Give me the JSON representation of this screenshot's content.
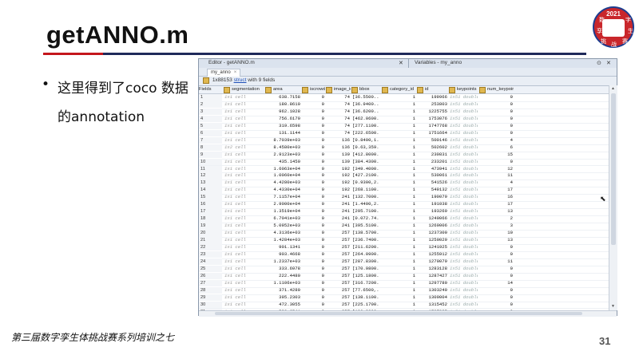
{
  "slide": {
    "title": "getANNO.m",
    "bullet": "•",
    "text": "这里得到了coco 数据的annotation",
    "footer": "第三届数字孪生体挑战赛系列培训之七",
    "page_number": "31"
  },
  "logo": {
    "year": "2021",
    "chars": [
      "数",
      "字",
      "孪",
      "生",
      "挑",
      "战",
      "赛"
    ]
  },
  "window": {
    "editor_title": "Editor - getANNO.m",
    "variables_title": "Variables - my_anno",
    "tab_label": "my_anno",
    "info_size": "1x88153",
    "info_type": "struct",
    "info_suffix": "with 9 fields",
    "colors": {
      "accent_red": "#c4161c",
      "accent_navy": "#1f2a5a",
      "struct_icon": "#e0b850"
    },
    "columns": [
      "Fields",
      "segmentation",
      "area",
      "iscrowd",
      "image_id",
      "bbox",
      "category_id",
      "id",
      "keypoints",
      "num_keypoints"
    ],
    "rows": [
      [
        "1",
        "1x1 cell",
        "638.7158",
        "0",
        "74",
        "[36.5500...",
        "1",
        "199966",
        "1x51 double",
        "0"
      ],
      [
        "2",
        "1x1 cell",
        "180.8610",
        "0",
        "74",
        "[36.9400...",
        "1",
        "253803",
        "1x51 double",
        "0"
      ],
      [
        "3",
        "1x1 cell",
        "962.1028",
        "0",
        "74",
        "[36.6200...",
        "1",
        "1225755",
        "1x51 double",
        "0"
      ],
      [
        "4",
        "1x1 cell",
        "756.6170",
        "0",
        "74",
        "[462.0600...",
        "1",
        "1753076",
        "1x51 double",
        "0"
      ],
      [
        "5",
        "1x1 cell",
        "319.6598",
        "0",
        "74",
        "[277.1100...",
        "1",
        "1747768",
        "1x51 double",
        "0"
      ],
      [
        "6",
        "1x1 cell",
        "131.1144",
        "0",
        "74",
        "[222.6500...",
        "1",
        "1751664",
        "1x51 double",
        "0"
      ],
      [
        "7",
        "1x1 cell",
        "8.7039e+03",
        "0",
        "136",
        "[0.8400,1...",
        "1",
        "500146",
        "1x51 double",
        "4"
      ],
      [
        "8",
        "1x2 cell",
        "8.4580e+03",
        "0",
        "136",
        "[0.63,359...",
        "1",
        "502602",
        "1x51 double",
        "6"
      ],
      [
        "9",
        "1x1 cell",
        "2.9123e+03",
        "0",
        "139",
        "[412.8000...",
        "1",
        "230831",
        "1x51 double",
        "15"
      ],
      [
        "10",
        "1x1 cell",
        "435.1450",
        "0",
        "139",
        "[384.4300...",
        "1",
        "233201",
        "1x51 double",
        "0"
      ],
      [
        "11",
        "1x1 cell",
        "1.6063e+04",
        "0",
        "192",
        "[349.4000...",
        "1",
        "473941",
        "1x51 double",
        "12"
      ],
      [
        "12",
        "1x1 cell",
        "1.0060e+04",
        "0",
        "192",
        "[427.2100...",
        "1",
        "530061",
        "1x51 double",
        "11"
      ],
      [
        "13",
        "1x1 cell",
        "4.4280e+03",
        "0",
        "192",
        "[0.9300,2...",
        "1",
        "541526",
        "1x51 double",
        "4"
      ],
      [
        "14",
        "1x1 cell",
        "4.4330e+04",
        "0",
        "192",
        "[268.1100...",
        "1",
        "549132",
        "1x51 double",
        "17"
      ],
      [
        "15",
        "1x1 cell",
        "7.1157e+04",
        "0",
        "241",
        "[132.7000...",
        "1",
        "190079",
        "1x51 double",
        "16"
      ],
      [
        "16",
        "1x1 cell",
        "2.9000e+04",
        "0",
        "241",
        "[1.4400,2...",
        "1",
        "191038",
        "1x51 double",
        "17"
      ],
      [
        "17",
        "1x1 cell",
        "1.3519e+04",
        "0",
        "241",
        "[295.7100...",
        "1",
        "193269",
        "1x51 double",
        "13"
      ],
      [
        "18",
        "1x1 cell",
        "6.7041e+03",
        "0",
        "241",
        "[0.072.74...",
        "1",
        "1240066",
        "1x51 double",
        "2"
      ],
      [
        "19",
        "1x1 cell",
        "5.0952e+03",
        "0",
        "241",
        "[395.5100...",
        "1",
        "1269006",
        "1x51 double",
        "3"
      ],
      [
        "20",
        "1x1 cell",
        "4.3136e+03",
        "0",
        "257",
        "[138.5700...",
        "1",
        "1237300",
        "1x51 double",
        "10"
      ],
      [
        "21",
        "1x1 cell",
        "1.4284e+03",
        "0",
        "257",
        "[236.7400...",
        "1",
        "1250029",
        "1x51 double",
        "13"
      ],
      [
        "22",
        "1x1 cell",
        "901.1341",
        "0",
        "257",
        "[211.6200...",
        "1",
        "1241925",
        "1x51 double",
        "0"
      ],
      [
        "23",
        "1x1 cell",
        "903.4668",
        "0",
        "257",
        "[264.0900...",
        "1",
        "1255912",
        "1x51 double",
        "0"
      ],
      [
        "24",
        "1x1 cell",
        "1.2337e+03",
        "0",
        "257",
        "[287.8300...",
        "1",
        "1270079",
        "1x51 double",
        "11"
      ],
      [
        "25",
        "1x1 cell",
        "333.6978",
        "0",
        "257",
        "[170.9800...",
        "1",
        "1283128",
        "1x51 double",
        "0"
      ],
      [
        "26",
        "1x1 cell",
        "222.4480",
        "0",
        "257",
        "[125.1800...",
        "1",
        "1287427",
        "1x51 double",
        "0"
      ],
      [
        "27",
        "1x1 cell",
        "1.1106e+03",
        "0",
        "257",
        "[316.7200...",
        "1",
        "1297780",
        "1x51 double",
        "14"
      ],
      [
        "28",
        "1x1 cell",
        "371.4280",
        "0",
        "257",
        "[77.6500,...",
        "1",
        "1303240",
        "1x51 double",
        "0"
      ],
      [
        "29",
        "1x1 cell",
        "395.2303",
        "0",
        "257",
        "[138.1100...",
        "1",
        "1309004",
        "1x51 double",
        "0"
      ],
      [
        "30",
        "1x1 cell",
        "472.3055",
        "0",
        "257",
        "[225.1700...",
        "1",
        "1315452",
        "1x51 double",
        "0"
      ],
      [
        "31",
        "1x1 cell",
        "523.6541",
        "0",
        "257",
        "[190.8300...",
        "1",
        "1707325",
        "1x51 double",
        "0"
      ]
    ]
  }
}
